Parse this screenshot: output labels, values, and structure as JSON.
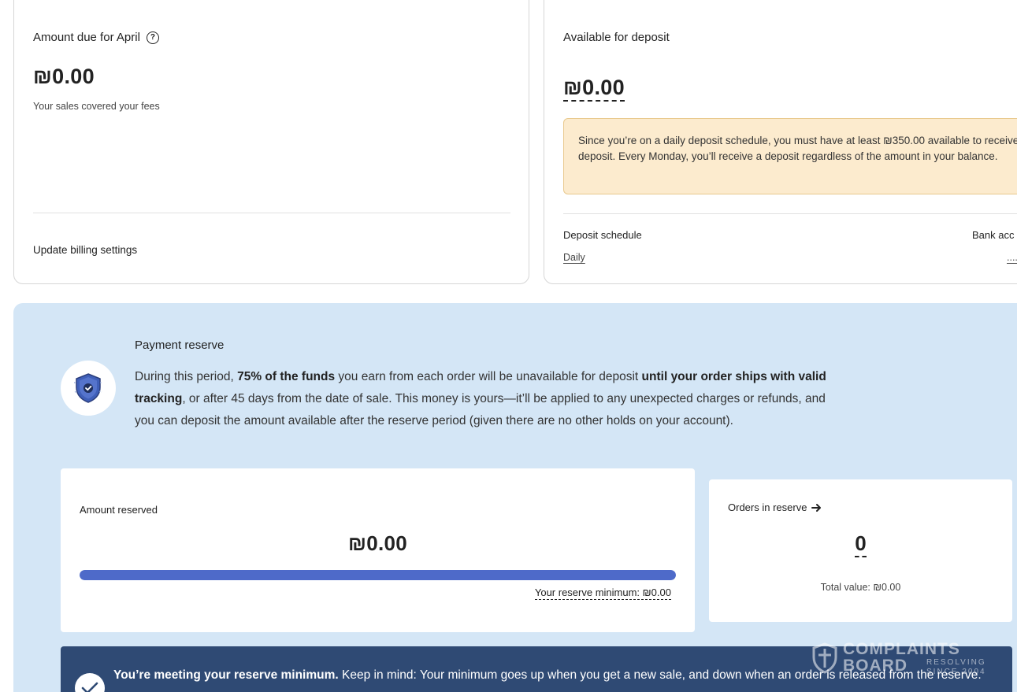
{
  "billing": {
    "title": "Amount due for April",
    "amount": "₪0.00",
    "subtitle": "Your sales covered your fees",
    "link": "Update billing settings"
  },
  "deposit": {
    "title": "Available for deposit",
    "amount": "₪0.00",
    "notice": "Since you’re on a daily deposit schedule, you must have at least ₪350.00 available to receive a deposit. Every Monday, you’ll receive a deposit regardless of the amount in your balance.",
    "schedule_label": "Deposit schedule",
    "schedule_value": "Daily",
    "bank_label": "Bank acc",
    "bank_value": "...."
  },
  "reserve": {
    "title": "Payment reserve",
    "desc_pre": "During this period, ",
    "desc_bold1": "75% of the funds",
    "desc_mid": " you earn from each order will be unavailable for deposit ",
    "desc_bold2": "until your order ships with valid tracking",
    "desc_post": ", or after 45 days from the date of sale. This money is yours—it’ll be applied to any unexpected charges or refunds, and you can deposit the amount available after the reserve period (given there are no other holds on your account).",
    "amount_reserved_label": "Amount reserved",
    "amount_reserved": "₪0.00",
    "progress_percent": 100,
    "minimum_text": "Your reserve minimum: ₪0.00",
    "orders_label": "Orders in reserve",
    "orders_count": "0",
    "total_value": "Total value: ₪0.00",
    "success_bold": "You’re meeting your reserve minimum.",
    "success_text": " Keep in mind: Your minimum goes up when you get a new sale, and down when an order is released from the reserve."
  },
  "watermark": {
    "main": "COMPLAINTS BOARD",
    "sub": "RESOLVING SINCE 2004"
  },
  "colors": {
    "notice_bg": "#fcebce",
    "reserve_bg": "#d4e6f6",
    "progress": "#4e6ac9",
    "success_bg": "#2f4a74"
  },
  "icons": {
    "help": "question-circle-icon",
    "shield": "shield-check-icon",
    "arrow": "arrow-right-icon",
    "check": "checkmark-icon"
  }
}
